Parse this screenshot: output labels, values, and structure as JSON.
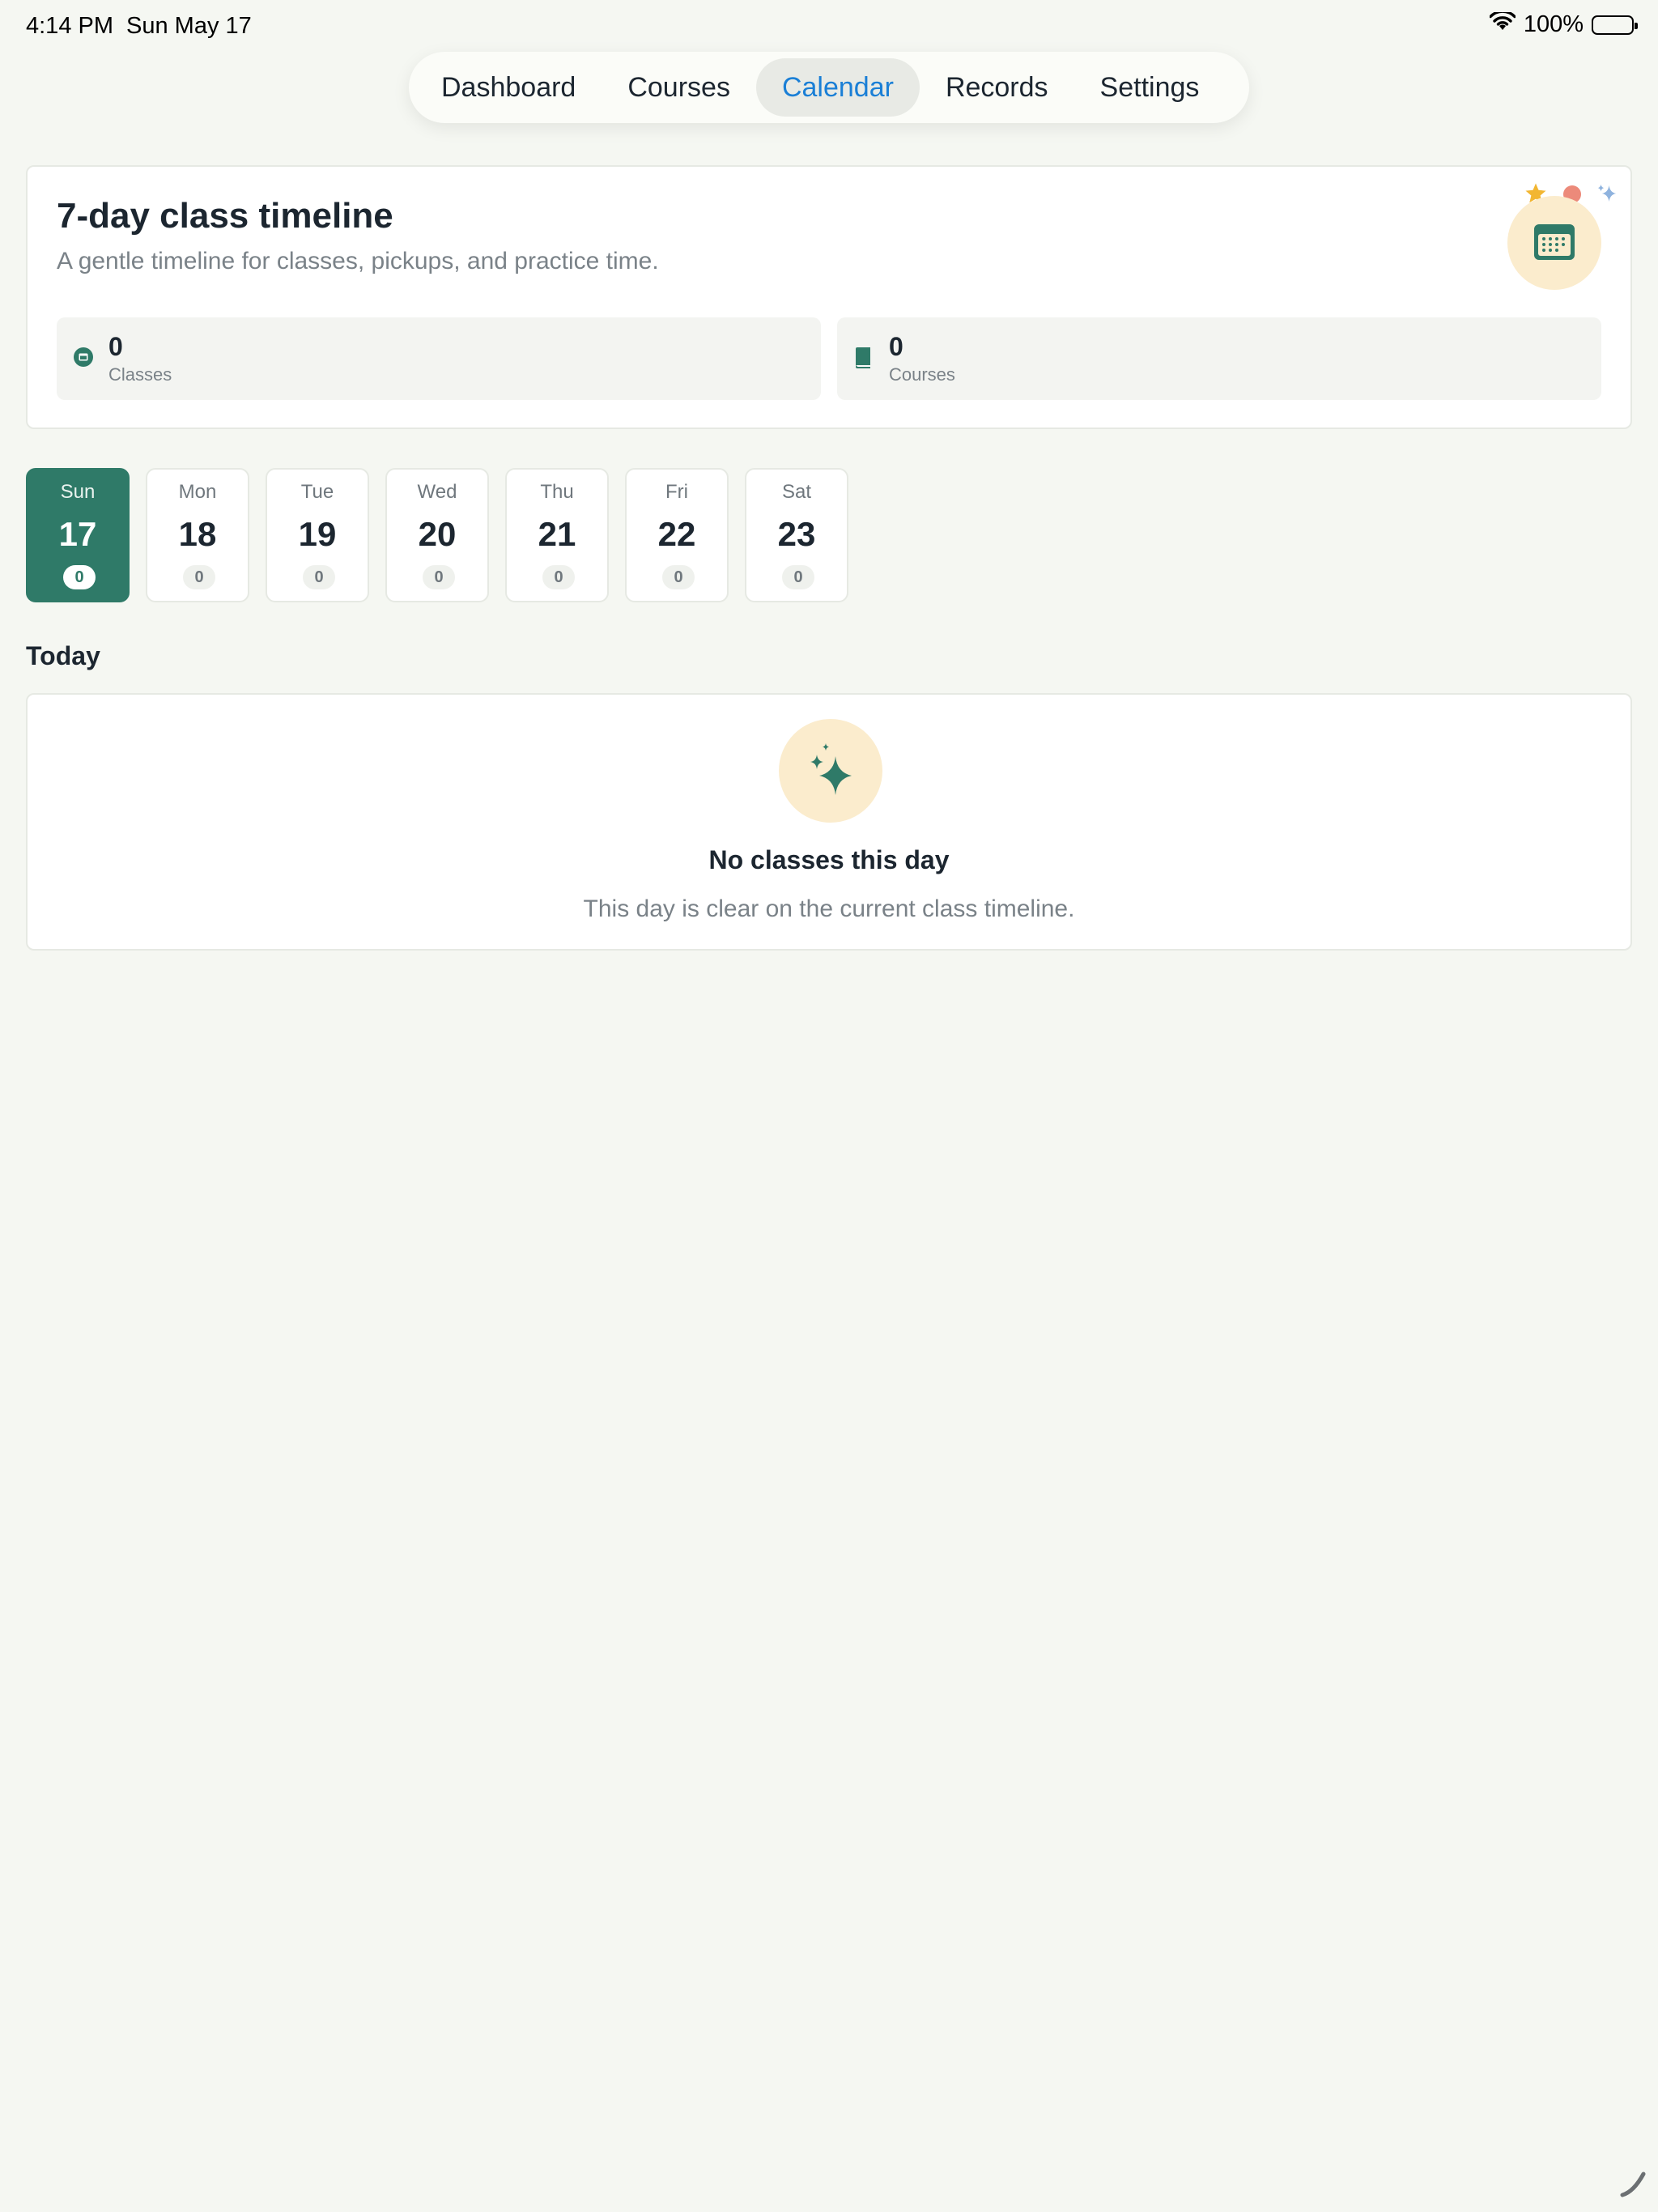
{
  "status_bar": {
    "time": "4:14 PM",
    "date": "Sun May 17",
    "battery": "100%"
  },
  "tabs": [
    {
      "label": "Dashboard",
      "active": false
    },
    {
      "label": "Courses",
      "active": false
    },
    {
      "label": "Calendar",
      "active": true
    },
    {
      "label": "Records",
      "active": false
    },
    {
      "label": "Settings",
      "active": false
    }
  ],
  "hero": {
    "title": "7-day class timeline",
    "subtitle": "A gentle timeline for classes, pickups, and practice time.",
    "stats": [
      {
        "value": "0",
        "label": "Classes",
        "icon": "calendar-icon"
      },
      {
        "value": "0",
        "label": "Courses",
        "icon": "book-icon"
      }
    ]
  },
  "days": [
    {
      "name": "Sun",
      "num": "17",
      "count": "0",
      "selected": true
    },
    {
      "name": "Mon",
      "num": "18",
      "count": "0",
      "selected": false
    },
    {
      "name": "Tue",
      "num": "19",
      "count": "0",
      "selected": false
    },
    {
      "name": "Wed",
      "num": "20",
      "count": "0",
      "selected": false
    },
    {
      "name": "Thu",
      "num": "21",
      "count": "0",
      "selected": false
    },
    {
      "name": "Fri",
      "num": "22",
      "count": "0",
      "selected": false
    },
    {
      "name": "Sat",
      "num": "23",
      "count": "0",
      "selected": false
    }
  ],
  "section": {
    "title": "Today"
  },
  "empty_state": {
    "title": "No classes this day",
    "subtitle": "This day is clear on the current class timeline.",
    "icon": "sparkles-icon"
  },
  "colors": {
    "accent": "#2f7a68",
    "tab_active_text": "#1a7fd6",
    "badge_bg": "#fbeccd",
    "background": "#f5f7f2"
  }
}
